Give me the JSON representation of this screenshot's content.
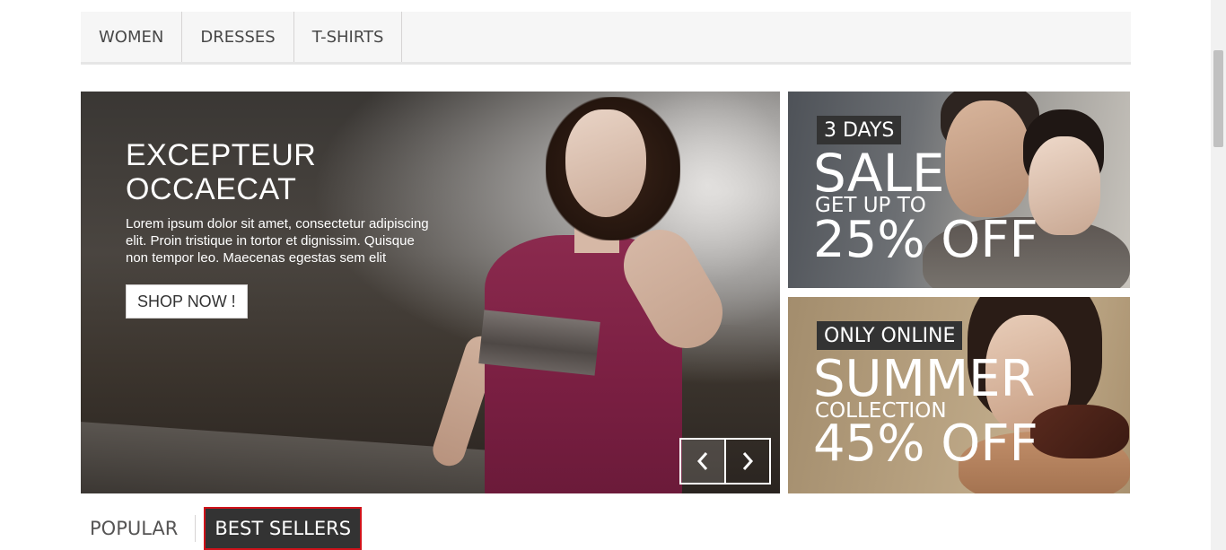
{
  "menu": {
    "items": [
      {
        "label": "Women"
      },
      {
        "label": "Dresses"
      },
      {
        "label": "T-shirts"
      }
    ]
  },
  "slider": {
    "title": "EXCEPTEUR OCCAECAT",
    "description": "Lorem ipsum dolor sit amet, consectetur adipiscing elit. Proin tristique in tortor et dignissim. Quisque non tempor leo. Maecenas egestas sem elit",
    "button_label": "SHOP NOW !",
    "prev_icon": "chevron-left-icon",
    "next_icon": "chevron-right-icon"
  },
  "banners": [
    {
      "tag": "3 DAYS",
      "headline": "SALE",
      "sub": "GET UP TO",
      "offer": "25% OFF"
    },
    {
      "tag": "ONLY ONLINE",
      "headline": "SUMMER",
      "sub": "COLLECTION",
      "offer": "45% OFF"
    }
  ],
  "tabs": {
    "popular": "Popular",
    "best_sellers": "Best Sellers",
    "active": "best_sellers"
  },
  "colors": {
    "tab_active_bg": "#333333",
    "tab_active_border": "#d0121a",
    "menu_bg": "#f6f6f6"
  }
}
